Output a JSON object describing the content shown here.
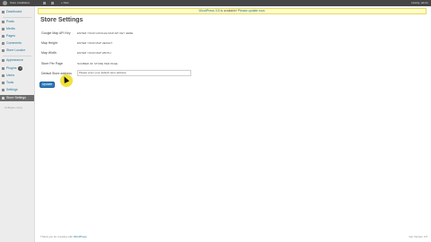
{
  "admin_bar": {
    "site_name": "Store Installation",
    "new_label": "+ New",
    "user_label": "Howdy, admin"
  },
  "sidebar": {
    "items": [
      {
        "label": "Dashboard",
        "icon": "dashboard-icon"
      },
      {
        "label": "Posts",
        "icon": "pin-icon"
      },
      {
        "label": "Media",
        "icon": "media-icon"
      },
      {
        "label": "Pages",
        "icon": "page-icon"
      },
      {
        "label": "Comments",
        "icon": "comment-icon"
      },
      {
        "label": "Store Locator",
        "icon": "location-icon"
      },
      {
        "label": "Appearance",
        "icon": "brush-icon"
      },
      {
        "label": "Plugins",
        "icon": "plugin-icon",
        "badge": "1"
      },
      {
        "label": "Users",
        "icon": "users-icon"
      },
      {
        "label": "Tools",
        "icon": "wrench-icon"
      },
      {
        "label": "Settings",
        "icon": "settings-icon"
      },
      {
        "label": "Store Settings",
        "icon": "store-icon"
      }
    ],
    "collapse_label": "Collapse menu"
  },
  "notice": {
    "link": "WordPress 3.5",
    "text": " is available! ",
    "link2": "Please update now."
  },
  "main": {
    "title": "Store Settings",
    "fields": [
      {
        "label": "Google Map API Key",
        "value": "ENTER YOUR GOOGLE MAP API KEY HERE"
      },
      {
        "label": "Map Height",
        "value": "ENTER YOUR MAP HEIGHT"
      },
      {
        "label": "Map Width",
        "value": "ENTER YOUR MAP WIDTH"
      },
      {
        "label": "Store Per Page",
        "value": "NUMBER OF STORE PER PAGE"
      },
      {
        "label": "Default Store address",
        "value": "Please enter your default store address"
      }
    ],
    "update_label": "Update"
  },
  "footer": {
    "left_text": "Thank you for creating with ",
    "left_link": "WordPress",
    "right_text": "Get Version 3.5"
  }
}
